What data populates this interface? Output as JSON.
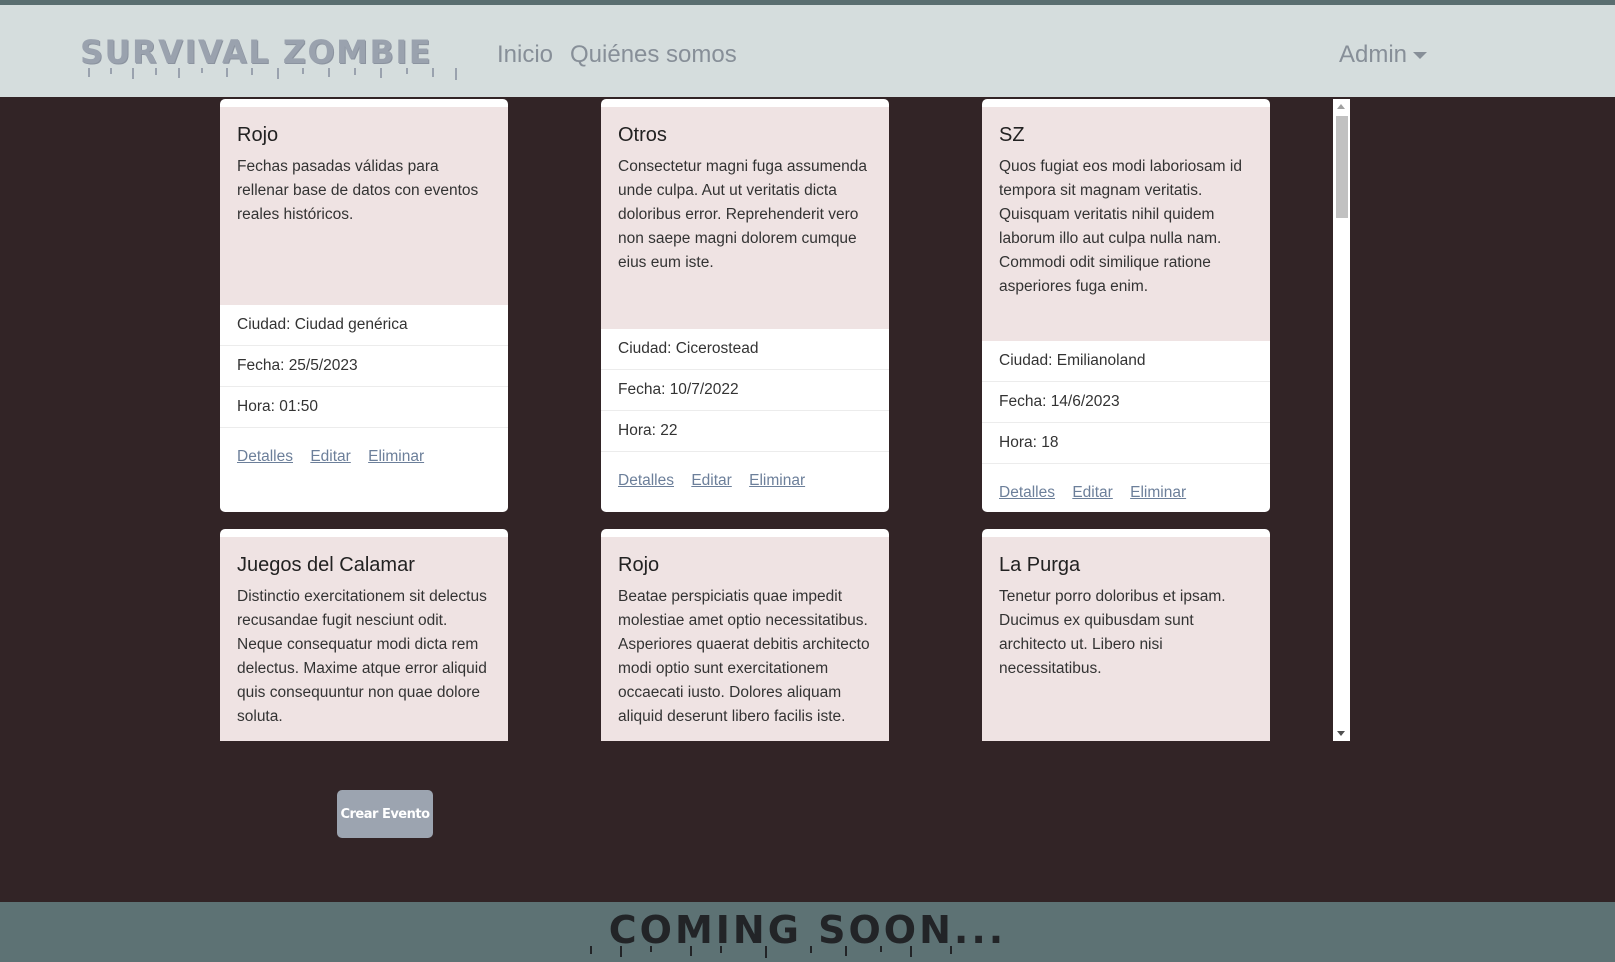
{
  "nav": {
    "brand": "SURVIVAL ZOMBIE",
    "links": [
      "Inicio",
      "Quiénes somos"
    ],
    "admin": "Admin"
  },
  "cards": [
    {
      "title": "Rojo",
      "text": "Fechas pasadas válidas para rellenar base de datos con eventos reales históricos.",
      "city": "Ciudad: Ciudad genérica",
      "date": "Fecha: 25/5/2023",
      "time": "Hora: 01:50",
      "links": [
        "Detalles",
        "Editar",
        "Eliminar"
      ]
    },
    {
      "title": "Otros",
      "text": "Consectetur magni fuga assumenda unde culpa. Aut ut veritatis dicta doloribus error. Reprehenderit vero non saepe magni dolorem cumque eius eum iste.",
      "city": "Ciudad: Cicerostead",
      "date": "Fecha: 10/7/2022",
      "time": "Hora: 22",
      "links": [
        "Detalles",
        "Editar",
        "Eliminar"
      ]
    },
    {
      "title": "SZ",
      "text": "Quos fugiat eos modi laboriosam id tempora sit magnam veritatis. Quisquam veritatis nihil quidem laborum illo aut culpa nulla nam. Commodi odit similique ratione asperiores fuga enim.",
      "city": "Ciudad: Emilianoland",
      "date": "Fecha: 14/6/2023",
      "time": "Hora: 18",
      "links": [
        "Detalles",
        "Editar",
        "Eliminar"
      ]
    },
    {
      "title": "Juegos del Calamar",
      "text": "Distinctio exercitationem sit delectus recusandae fugit nesciunt odit. Neque consequatur modi dicta rem delectus. Maxime atque error aliquid quis consequuntur non quae dolore soluta."
    },
    {
      "title": "Rojo",
      "text": "Beatae perspiciatis quae impedit molestiae amet optio necessitatibus. Asperiores quaerat debitis architecto modi optio sunt exercitationem occaecati iusto. Dolores aliquam aliquid deserunt libero facilis iste."
    },
    {
      "title": "La Purga",
      "text": "Tenetur porro doloribus et ipsam. Ducimus ex quibusdam sunt architecto ut. Libero nisi necessitatibus."
    }
  ],
  "create_button": "Crear Evento",
  "footer": {
    "text": "COMING SOON..."
  },
  "colors": {
    "page_bg": "#322426",
    "navbar_bg": "#d5dddd",
    "card_body_bg": "#efe3e3",
    "footer_bg": "#5d7274",
    "link": "#6c7f9a",
    "button_bg": "#9ca4b0"
  }
}
